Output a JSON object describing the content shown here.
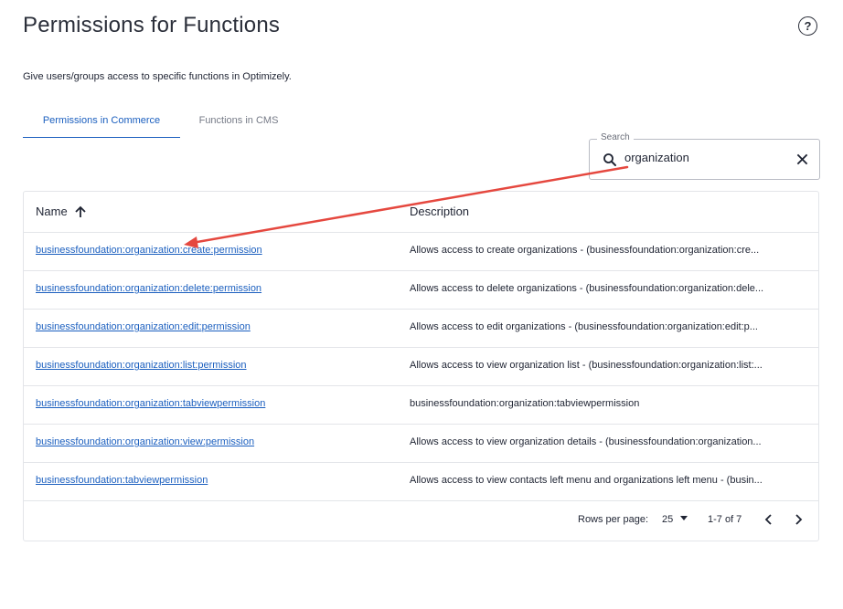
{
  "page": {
    "title": "Permissions for Functions",
    "subtitle": "Give users/groups access to specific functions in Optimizely.",
    "help_icon": "help-circle-icon"
  },
  "tabs": [
    {
      "label": "Permissions in Commerce",
      "active": true
    },
    {
      "label": "Functions in CMS",
      "active": false
    }
  ],
  "search": {
    "label": "Search",
    "value": "organization",
    "icon": "search-icon",
    "clear_icon": "close-icon"
  },
  "table": {
    "columns": {
      "name": "Name",
      "description": "Description"
    },
    "sort_icon": "arrow-up-icon",
    "rows": [
      {
        "name": "businessfoundation:organization:create:permission",
        "description": "Allows access to create organizations - (businessfoundation:organization:cre..."
      },
      {
        "name": "businessfoundation:organization:delete:permission",
        "description": "Allows access to delete organizations - (businessfoundation:organization:dele..."
      },
      {
        "name": "businessfoundation:organization:edit:permission",
        "description": "Allows access to edit organizations - (businessfoundation:organization:edit:p..."
      },
      {
        "name": "businessfoundation:organization:list:permission",
        "description": "Allows access to view organization list - (businessfoundation:organization:list:..."
      },
      {
        "name": "businessfoundation:organization:tabviewpermission",
        "description": "businessfoundation:organization:tabviewpermission"
      },
      {
        "name": "businessfoundation:organization:view:permission",
        "description": "Allows access to view organization details - (businessfoundation:organization..."
      },
      {
        "name": "businessfoundation:tabviewpermission",
        "description": "Allows access to view contacts left menu and organizations left menu - (busin..."
      }
    ]
  },
  "pagination": {
    "rows_per_page_label": "Rows per page:",
    "rows_per_page_value": "25",
    "range": "1-7 of 7",
    "prev_icon": "chevron-left-icon",
    "next_icon": "chevron-right-icon"
  },
  "colors": {
    "accent": "#1b5fbf",
    "annotation_arrow": "#e5483f"
  }
}
